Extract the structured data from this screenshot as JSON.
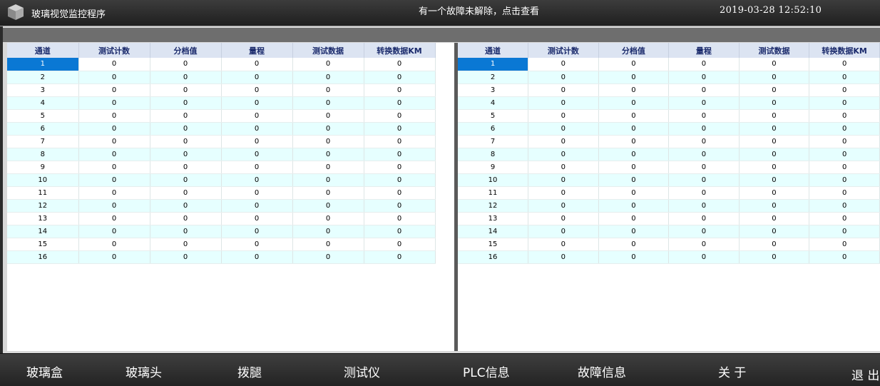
{
  "header": {
    "title": "玻璃视觉监控程序",
    "fault_message": "有一个故障未解除，点击查看",
    "datetime": "2019-03-28 12:52:10"
  },
  "left_table": {
    "columns": [
      "通道",
      "测试计数",
      "分档值",
      "量程",
      "测试数据",
      "转换数据KM"
    ],
    "selected_row": 1
  },
  "right_table": {
    "columns": [
      "通道",
      "测试计数",
      "分档值",
      "量程",
      "测试数据",
      "转换数据KM"
    ],
    "selected_row": 1
  },
  "rows": [
    [
      "1",
      "0",
      "0",
      "0",
      "0",
      "0"
    ],
    [
      "2",
      "0",
      "0",
      "0",
      "0",
      "0"
    ],
    [
      "3",
      "0",
      "0",
      "0",
      "0",
      "0"
    ],
    [
      "4",
      "0",
      "0",
      "0",
      "0",
      "0"
    ],
    [
      "5",
      "0",
      "0",
      "0",
      "0",
      "0"
    ],
    [
      "6",
      "0",
      "0",
      "0",
      "0",
      "0"
    ],
    [
      "7",
      "0",
      "0",
      "0",
      "0",
      "0"
    ],
    [
      "8",
      "0",
      "0",
      "0",
      "0",
      "0"
    ],
    [
      "9",
      "0",
      "0",
      "0",
      "0",
      "0"
    ],
    [
      "10",
      "0",
      "0",
      "0",
      "0",
      "0"
    ],
    [
      "11",
      "0",
      "0",
      "0",
      "0",
      "0"
    ],
    [
      "12",
      "0",
      "0",
      "0",
      "0",
      "0"
    ],
    [
      "13",
      "0",
      "0",
      "0",
      "0",
      "0"
    ],
    [
      "14",
      "0",
      "0",
      "0",
      "0",
      "0"
    ],
    [
      "15",
      "0",
      "0",
      "0",
      "0",
      "0"
    ],
    [
      "16",
      "0",
      "0",
      "0",
      "0",
      "0"
    ]
  ],
  "nav": {
    "items": [
      "玻璃盒",
      "玻璃头",
      "拨腿",
      "测试仪",
      "PLC信息",
      "故障信息",
      "关 于",
      "退 出"
    ]
  },
  "icons": {
    "logo": "cube-icon"
  },
  "colors": {
    "selected_cell": "#0a78d4",
    "row_alt": "#e6ffff",
    "header_bg": "#dce4f2"
  }
}
